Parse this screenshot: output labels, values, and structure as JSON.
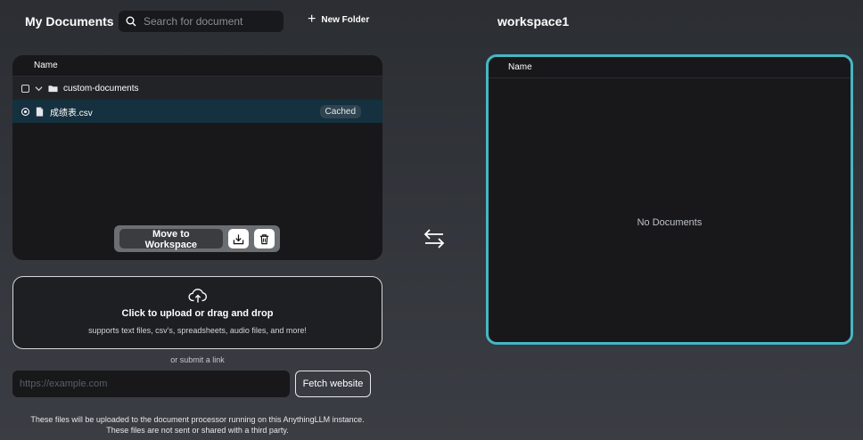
{
  "header": {
    "title": "My Documents",
    "search_placeholder": "Search for document",
    "new_folder_label": "New Folder",
    "workspace_title": "workspace1"
  },
  "documents": {
    "column_name": "Name",
    "folder": {
      "name": "custom-documents"
    },
    "file": {
      "name": "成绩表.csv",
      "badge": "Cached"
    }
  },
  "actions": {
    "move_label": "Move to Workspace",
    "save_icon": "download-tray-icon",
    "delete_icon": "trash-icon"
  },
  "upload": {
    "title": "Click to upload or drag and drop",
    "subtitle": "supports text files, csv's, spreadsheets, audio files, and more!",
    "or_link": "or submit a link",
    "url_placeholder": "https://example.com",
    "fetch_label": "Fetch website",
    "footer_line1": "These files will be uploaded to the document processor running on this AnythingLLM instance.",
    "footer_line2": "These files are not sent or shared with a third party."
  },
  "workspace": {
    "column_name": "Name",
    "empty_text": "No Documents"
  },
  "colors": {
    "accent": "#45b7c4",
    "selected_row": "#15303e"
  }
}
